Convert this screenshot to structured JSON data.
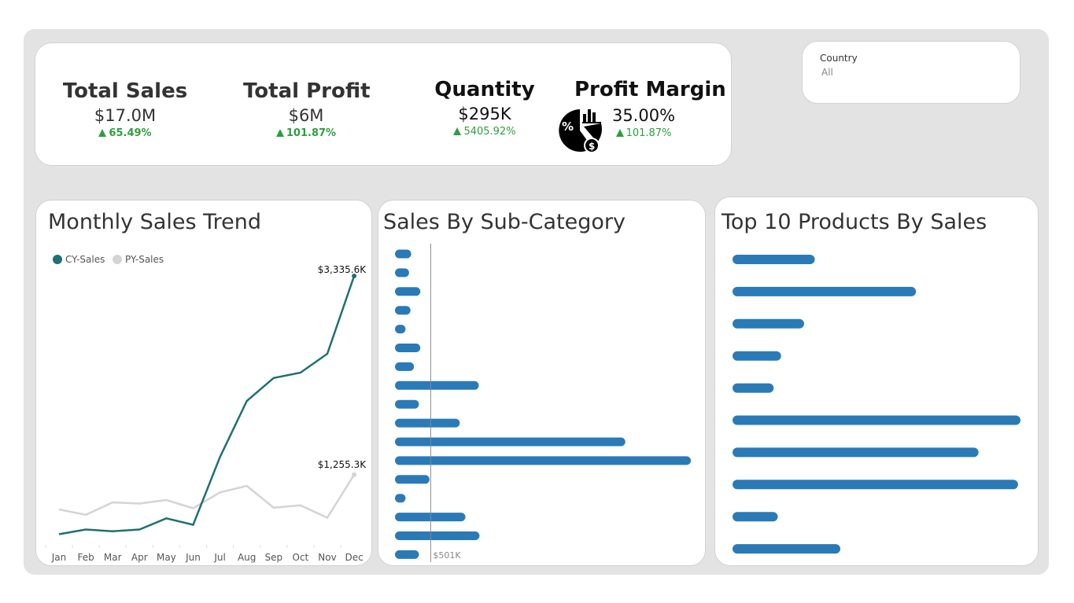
{
  "kpis": {
    "total_sales": {
      "title": "Total Sales",
      "value": "$17.0M",
      "change": "65.49%"
    },
    "total_profit": {
      "title": "Total Profit",
      "value": "$6M",
      "change": "101.87%"
    },
    "quantity": {
      "title": "Quantity",
      "value": "$295K",
      "change": "5405.92%"
    },
    "profit_margin": {
      "title": "Profit Margin",
      "value": "35.00%",
      "change": "101.87%",
      "icon": "profit-margin-pie-icon"
    }
  },
  "filter": {
    "label": "Country",
    "value": "All"
  },
  "colors": {
    "cy": "#1f7074",
    "py": "#d4d4d4",
    "bar": "#2a7ab8",
    "up": "#2e9e3e"
  },
  "chart_data": [
    {
      "type": "line",
      "title": "Monthly Sales Trend",
      "x": [
        "Jan",
        "Feb",
        "Mar",
        "Apr",
        "May",
        "Jun",
        "Jul",
        "Aug",
        "Sep",
        "Oct",
        "Nov",
        "Dec"
      ],
      "series": [
        {
          "name": "CY-Sales",
          "values": [
            340,
            420,
            390,
            420,
            610,
            500,
            1650,
            2600,
            2990,
            3080,
            3400,
            4720
          ],
          "end_label": "$3,335.6K"
        },
        {
          "name": "PY-Sales",
          "values": [
            760,
            670,
            880,
            860,
            920,
            780,
            1050,
            1160,
            790,
            830,
            620,
            1350
          ],
          "end_label": "$1,255.3K"
        }
      ],
      "legend": "top-left",
      "grid": false
    },
    {
      "type": "bar",
      "orientation": "horizontal",
      "title": "Sales By Sub-Category",
      "values": [
        230,
        200,
        360,
        220,
        150,
        360,
        270,
        1190,
        340,
        920,
        3270,
        4200,
        490,
        150,
        1000,
        1200,
        340
      ],
      "reference_line": {
        "value": 501,
        "label": "$501K"
      }
    },
    {
      "type": "bar",
      "orientation": "horizontal",
      "title": "Top 10 Products By Sales",
      "values": [
        1000,
        2230,
        870,
        590,
        500,
        3500,
        2990,
        3470,
        550,
        1310
      ]
    }
  ]
}
